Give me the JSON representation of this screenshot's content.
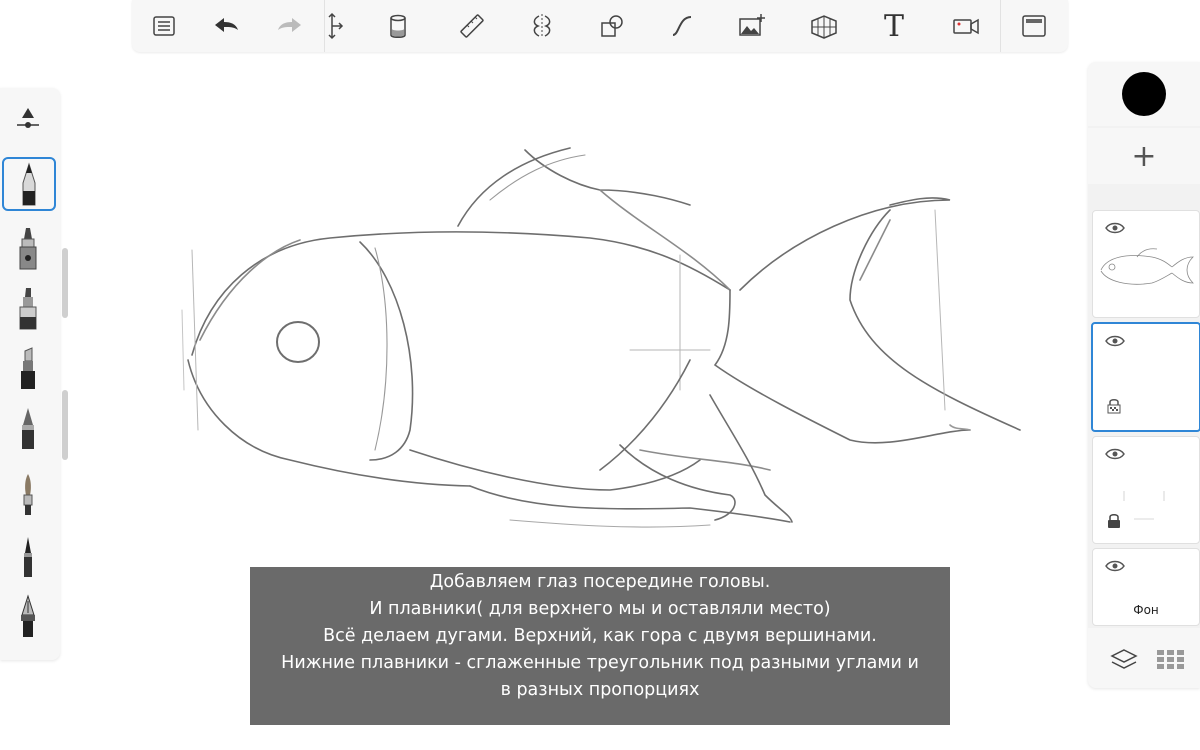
{
  "toolbar": {
    "items": [
      {
        "name": "menu-list-icon"
      },
      {
        "name": "undo-icon"
      },
      {
        "name": "redo-icon"
      },
      {
        "name": "transform-icon"
      },
      {
        "name": "paint-bucket-icon"
      },
      {
        "name": "ruler-icon"
      },
      {
        "name": "symmetry-icon"
      },
      {
        "name": "shapes-icon"
      },
      {
        "name": "curve-icon"
      },
      {
        "name": "import-image-icon"
      },
      {
        "name": "perspective-grid-icon"
      },
      {
        "name": "text-icon",
        "label": "T"
      },
      {
        "name": "time-lapse-icon"
      },
      {
        "name": "fullscreen-icon"
      }
    ]
  },
  "brushes": {
    "selected_index": 0,
    "items": [
      "pencil-brush-icon",
      "airbrush-brush-icon",
      "marker-brush-icon",
      "chisel-marker-brush-icon",
      "ballpoint-pen-brush-icon",
      "paintbrush-brush-icon",
      "ink-pen-brush-icon",
      "fountain-pen-brush-icon"
    ]
  },
  "right_panel": {
    "current_color": "#000000",
    "add_layer_label": "+",
    "layers": [
      {
        "name": "sketch-layer",
        "visible": true,
        "active": false,
        "label": ""
      },
      {
        "name": "layer-2",
        "visible": true,
        "active": true,
        "label": ""
      },
      {
        "name": "layer-3",
        "visible": true,
        "active": false,
        "label": ""
      },
      {
        "name": "background-layer",
        "visible": true,
        "active": false,
        "label": "Фон"
      }
    ]
  },
  "caption": {
    "lines": [
      "Добавляем глаз посередине головы.",
      "И плавники( для верхнего мы и оставляли место)",
      "Всё делаем дугами. Верхний, как гора с двумя вершинами.",
      "Нижние плавники - сглаженные треугольник под разными углами и",
      "в разных пропорциях"
    ]
  },
  "colors": {
    "accent": "#2f86d6",
    "caption_bg": "#6a6a6a",
    "toolbar_bg": "#f7f7f7"
  }
}
